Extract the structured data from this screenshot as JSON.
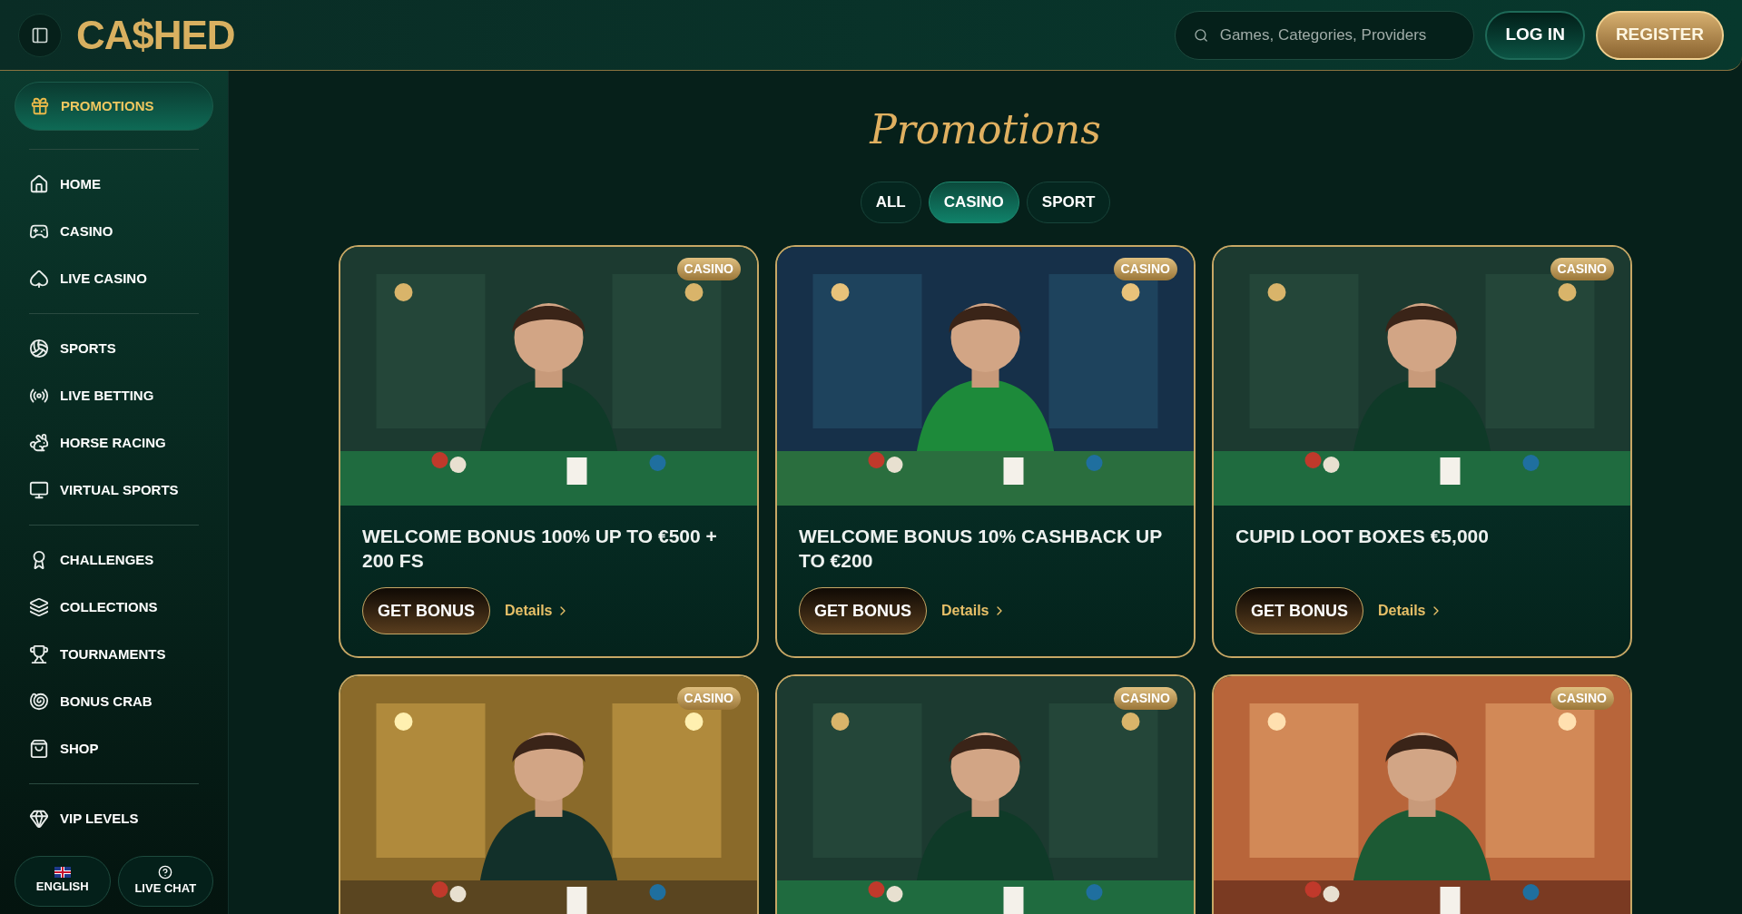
{
  "header": {
    "logo": "CA$HED",
    "search": {
      "placeholder": "Games, Categories, Providers"
    },
    "buttons": [
      {
        "kind": "login",
        "label": "LOG IN"
      },
      {
        "kind": "register",
        "label": "REGISTER"
      }
    ]
  },
  "sidebar": {
    "groups": [
      [
        {
          "label": "PROMOTIONS",
          "selected": true
        }
      ],
      [
        {
          "label": "HOME",
          "selected": false
        },
        {
          "label": "CASINO",
          "selected": false
        },
        {
          "label": "LIVE CASINO",
          "selected": false
        }
      ],
      [
        {
          "label": "SPORTS",
          "selected": false
        },
        {
          "label": "LIVE BETTING",
          "selected": false
        },
        {
          "label": "HORSE RACING",
          "selected": false
        },
        {
          "label": "VIRTUAL SPORTS",
          "selected": false
        }
      ],
      [
        {
          "label": "CHALLENGES",
          "selected": false
        },
        {
          "label": "COLLECTIONS",
          "selected": false
        },
        {
          "label": "TOURNAMENTS",
          "selected": false
        },
        {
          "label": "BONUS CRAB",
          "selected": false
        },
        {
          "label": "SHOP",
          "selected": false
        }
      ],
      [
        {
          "label": "VIP LEVELS",
          "selected": false
        }
      ]
    ],
    "footer": [
      {
        "kind": "language",
        "label": "ENGLISH"
      },
      {
        "kind": "chat",
        "label": "LIVE CHAT"
      }
    ]
  },
  "page": {
    "title": "Promotions",
    "filters": [
      {
        "label": "ALL",
        "selected": false
      },
      {
        "label": "CASINO",
        "selected": true
      },
      {
        "label": "SPORT",
        "selected": false
      }
    ],
    "promotions": [
      {
        "tag": "CASINO",
        "title": "WELCOME BONUS 100% UP TO €500 + 200 FS",
        "button": "GET BONUS",
        "link": "Details"
      },
      {
        "tag": "CASINO",
        "title": "WELCOME BONUS 10% CASHBACK UP TO €200",
        "button": "GET BONUS",
        "link": "Details"
      },
      {
        "tag": "CASINO",
        "title": "CUPID LOOT BOXES €5,000",
        "button": "GET BONUS",
        "link": "Details"
      },
      {
        "tag": "CASINO"
      },
      {
        "tag": "CASINO"
      },
      {
        "tag": "CASINO"
      }
    ]
  }
}
